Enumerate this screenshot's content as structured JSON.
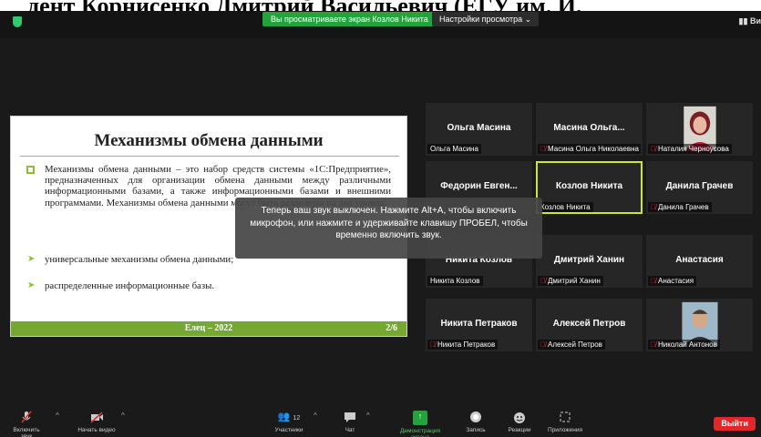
{
  "header_document_text": "дент Корнисенко Дмитрий Васильевич (ЕГУ им. И.",
  "top_bar": {
    "share_banner": "Вы просматриваете экран Козлов Никита",
    "view_options": "Настройки просмотра ⌄",
    "view_button": "▮▮ Ви"
  },
  "slide": {
    "title": "Механизмы обмена данными",
    "paragraph": "Механизмы обмена данными – это набор средств системы «1С:Предприятие», предназначенных для организации обмена данными между различными информационными базами, а также информационными базами и внешними программами. Механизмы обмена данными могут быть разделены на два уровня:",
    "items": [
      "универсальные механизмы обмена данными;",
      "распределенные информационные базы."
    ],
    "footer_city": "Елец – 2022",
    "footer_page": "2/6"
  },
  "participants": [
    {
      "name": "Ольга Масина",
      "label": "Ольга Масина",
      "muted": false
    },
    {
      "name": "Масина Ольга...",
      "label": "Масина Ольга Николаевна",
      "muted": true
    },
    {
      "name": "",
      "label": "Наталия Черноусова",
      "muted": true,
      "photo": "woman-photo"
    },
    {
      "name": "Федорин Евген...",
      "label": "",
      "muted": false
    },
    {
      "name": "Козлов Никита",
      "label": "Козлов Никита",
      "muted": false,
      "active": true
    },
    {
      "name": "Данила Грачев",
      "label": "Данила Грачев",
      "muted": true
    },
    {
      "name": "Никита Козлов",
      "label": "Никита Козлов",
      "muted": false
    },
    {
      "name": "Дмитрий Ханин",
      "label": "Дмитрий Ханин",
      "muted": true
    },
    {
      "name": "Анастасия",
      "label": "Анастасия",
      "muted": true
    },
    {
      "name": "Никита Петраков",
      "label": "Никита Петраков",
      "muted": true
    },
    {
      "name": "Алексей Петров",
      "label": "Алексей Петров",
      "muted": true
    },
    {
      "name": "",
      "label": "Николай Антонов",
      "muted": true,
      "photo": "man-photo"
    }
  ],
  "toast": "Теперь ваш звук выключен. Нажмите Alt+A, чтобы включить микрофон, или нажмите и удерживайте клавишу ПРОБЕЛ, чтобы временно включить звук.",
  "toolbar": {
    "unmute": "Включить звук",
    "start_video": "Начать видео",
    "participants": "Участники",
    "participants_count": "12",
    "chat": "Чат",
    "share_screen": "Демонстрация экрана",
    "record": "Запись",
    "reactions": "Реакции",
    "apps": "Приложения",
    "exit": "Выйти"
  },
  "colors": {
    "accent_green": "#23a33b",
    "slide_green": "#74a832",
    "active_border": "#c8e63c",
    "exit_red": "#e02828"
  }
}
